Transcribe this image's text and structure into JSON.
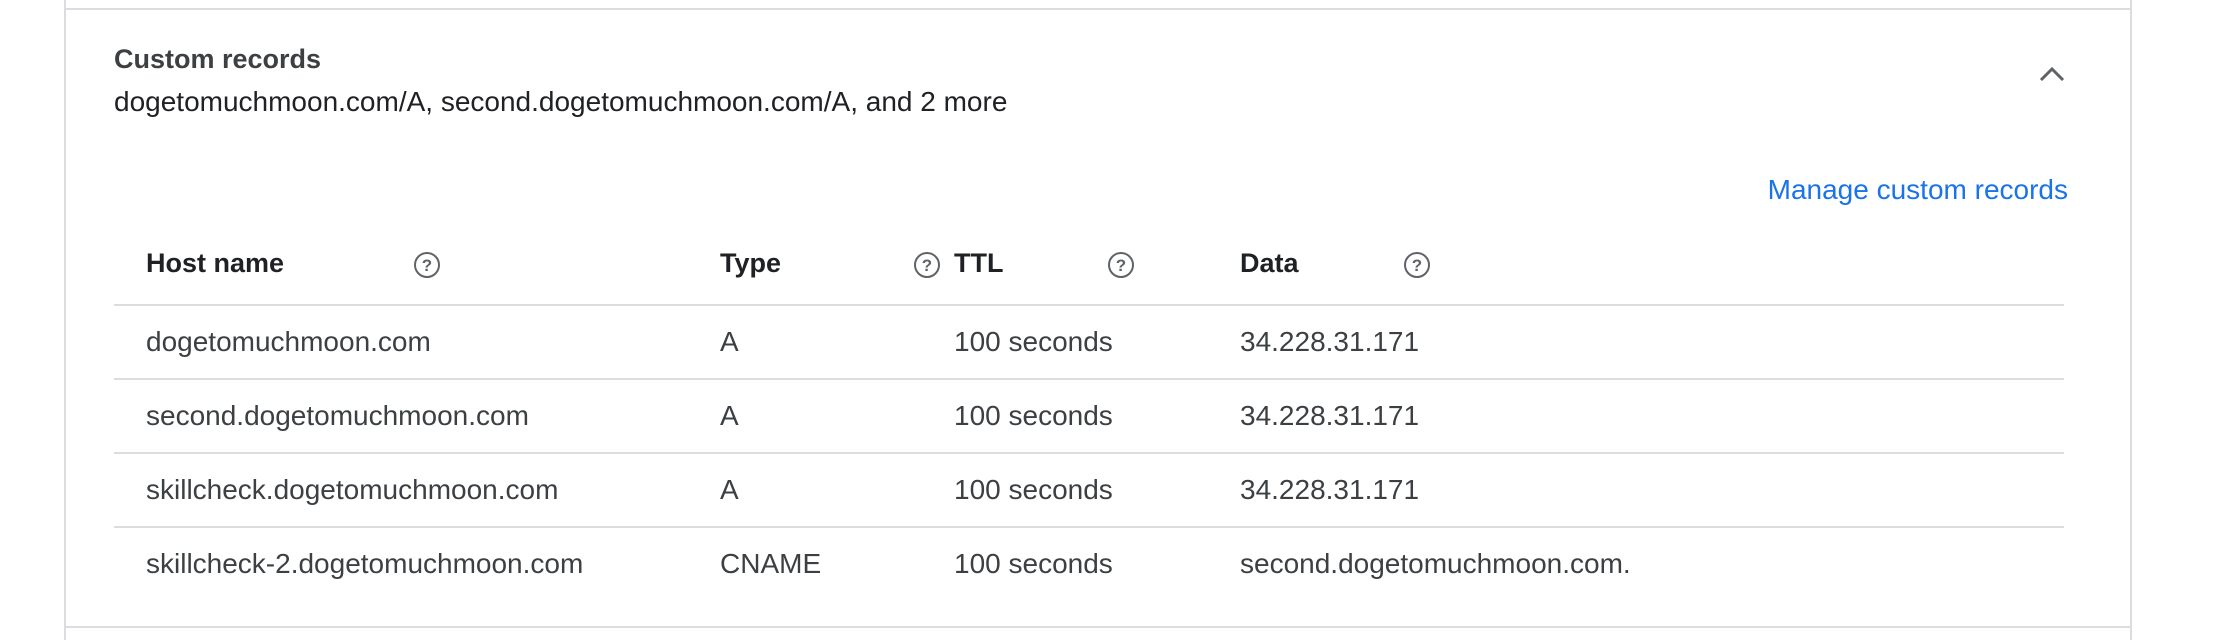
{
  "section": {
    "title": "Custom records",
    "summary": "dogetomuchmoon.com/A, second.dogetomuchmoon.com/A, and 2 more",
    "manage_link": "Manage custom records"
  },
  "table": {
    "headers": [
      "Host name",
      "Type",
      "TTL",
      "Data"
    ],
    "rows": [
      [
        "dogetomuchmoon.com",
        "A",
        "100 seconds",
        "34.228.31.171"
      ],
      [
        "second.dogetomuchmoon.com",
        "A",
        "100 seconds",
        "34.228.31.171"
      ],
      [
        "skillcheck.dogetomuchmoon.com",
        "A",
        "100 seconds",
        "34.228.31.171"
      ],
      [
        "skillcheck-2.dogetomuchmoon.com",
        "CNAME",
        "100 seconds",
        "second.dogetomuchmoon.com."
      ]
    ]
  },
  "icons": {
    "collapse": "chevron-up-icon",
    "help": "help-circle-icon"
  },
  "colors": {
    "link": "#1a73e8",
    "divider": "#dadce0",
    "text": "#3c4043"
  }
}
